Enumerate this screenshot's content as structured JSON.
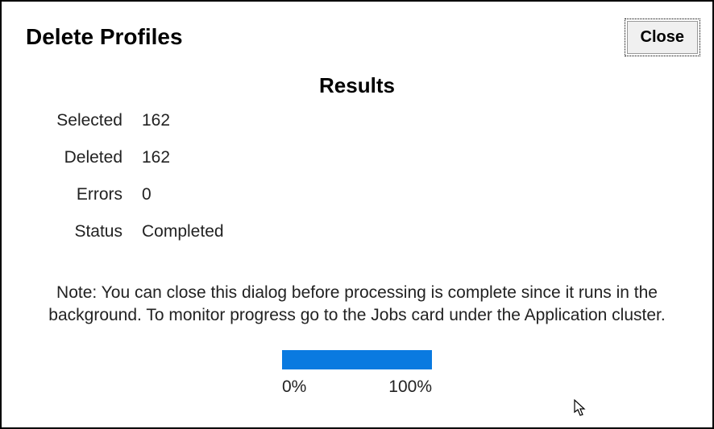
{
  "dialog": {
    "title": "Delete Profiles",
    "close_label": "Close"
  },
  "results": {
    "heading": "Results",
    "selected_label": "Selected",
    "selected_value": "162",
    "deleted_label": "Deleted",
    "deleted_value": "162",
    "errors_label": "Errors",
    "errors_value": "0",
    "status_label": "Status",
    "status_value": "Completed"
  },
  "note": "Note: You can close this dialog before processing is complete since it runs in the background. To monitor progress go to the Jobs card under the Application cluster.",
  "progress": {
    "percent": 100,
    "min_label": "0%",
    "max_label": "100%"
  }
}
